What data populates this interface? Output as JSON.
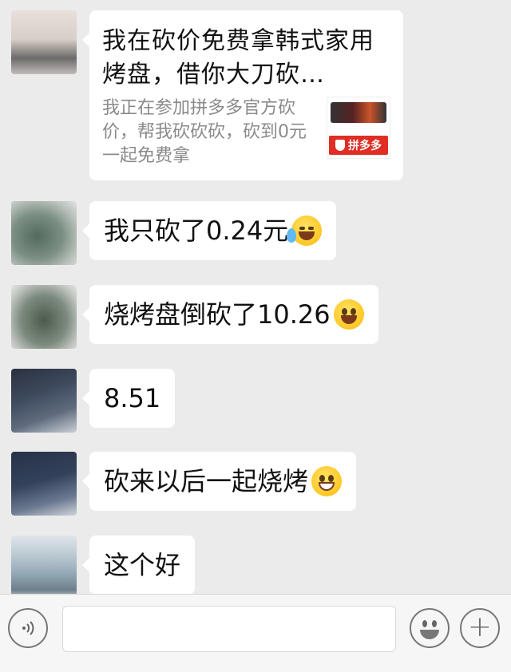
{
  "messages": [
    {
      "type": "link_card",
      "title": "我在砍价免费拿韩式家用烤盘，借你大刀砍…",
      "description": "我正在参加拼多多官方砍价，帮我砍砍砍，砍到0元一起免费拿",
      "thumb_badge": "拼多多"
    },
    {
      "type": "text",
      "text": "我只砍了0.24元",
      "emoji": "face-with-tears-icon"
    },
    {
      "type": "text",
      "text": "烧烤盘倒砍了10.26",
      "emoji": "hugging-face-icon"
    },
    {
      "type": "text",
      "text": "8.51"
    },
    {
      "type": "text",
      "text": "砍来以后一起烧烤",
      "emoji": "grinning-face-icon"
    },
    {
      "type": "text",
      "text": "这个好"
    }
  ],
  "input_bar": {
    "value": "",
    "icons": [
      "voice-icon",
      "emoji-icon",
      "plus-icon"
    ]
  },
  "colors": {
    "background": "#ebebeb",
    "bubble": "#ffffff",
    "badge_red": "#e02e24"
  }
}
